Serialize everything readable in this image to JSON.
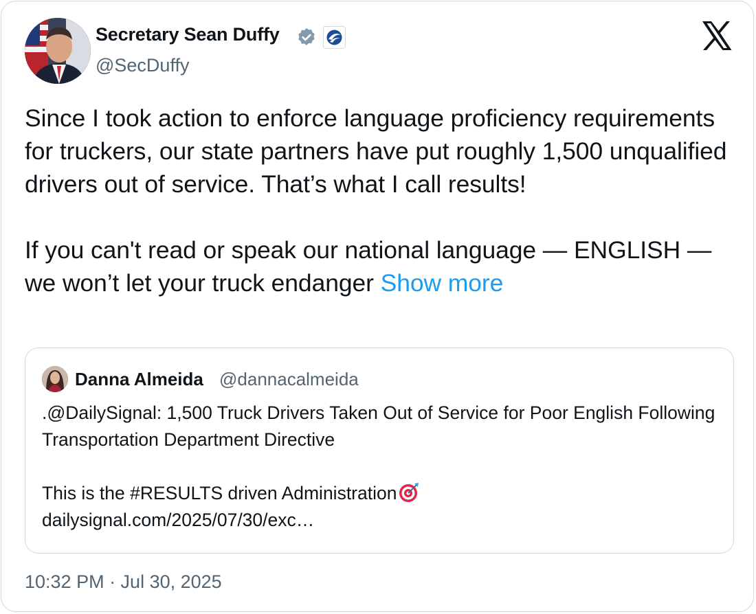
{
  "author": {
    "name": "Secretary Sean Duffy",
    "handle": "@SecDuffy"
  },
  "tweet": {
    "paragraph_1": "Since I took action to enforce language proficiency requirements for truckers, our state partners have put roughly 1,500 unqualified drivers out of service. That’s what I call results!",
    "paragraph_2": "If you can't read or speak our national language — ENGLISH — we won’t let your truck endanger ",
    "show_more": "Show more"
  },
  "quote": {
    "name": "Danna Almeida",
    "handle": "@dannacalmeida",
    "line_1": ".@DailySignal: 1,500 Truck Drivers Taken Out of Service for Poor English Following Transportation Department Directive",
    "line_2": "This is the #RESULTS driven Administration",
    "link": "dailysignal.com/2025/07/30/exc…"
  },
  "timestamp": "10:32 PM · Jul 30, 2025",
  "icons": {
    "verified": "verified-badge-icon",
    "affiliation": "dot-department-logo-icon",
    "platform": "x-logo-icon",
    "emoji": "target-emoji-icon"
  },
  "colors": {
    "link": "#1d9bf0",
    "verified_badge": "#829aab",
    "secondary_text": "#536471",
    "border": "#cfd9de"
  }
}
